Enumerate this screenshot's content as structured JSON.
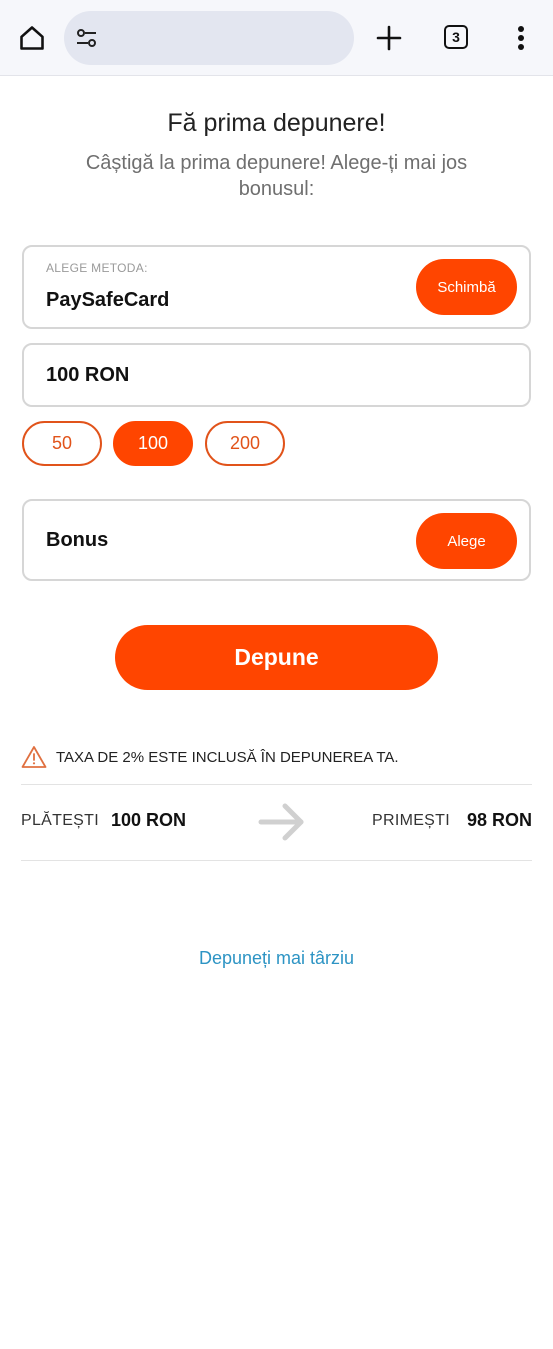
{
  "browser": {
    "tab_count": "3",
    "icons": {
      "home": "home-icon",
      "site_settings": "tune-icon",
      "new_tab": "plus-icon",
      "tabs": "tabs-icon",
      "menu": "more-vert-icon"
    }
  },
  "page": {
    "title": "Fă prima depunere!",
    "subtitle": "Câștigă la prima depunere! Alege-ți mai jos bonusul:"
  },
  "payment_method": {
    "label": "ALEGE METODA:",
    "value": "PaySafeCard",
    "change_label": "Schimbă"
  },
  "amount": {
    "value": "100 RON",
    "presets": [
      {
        "label": "50",
        "selected": false
      },
      {
        "label": "100",
        "selected": true
      },
      {
        "label": "200",
        "selected": false
      }
    ]
  },
  "bonus": {
    "label": "Bonus",
    "choose_label": "Alege"
  },
  "deposit_button_label": "Depune",
  "fee_notice": {
    "icon": "warning-icon",
    "text": "TAXA DE 2% ESTE INCLUSĂ ÎN DEPUNEREA TA."
  },
  "summary": {
    "pay_label": "PLĂTEȘTI",
    "pay_value": "100 RON",
    "arrow_icon": "arrow-right-icon",
    "receive_label": "PRIMEȘTI",
    "receive_value": "98 RON"
  },
  "later_link": "Depuneți mai târziu",
  "colors": {
    "accent": "#ff4500",
    "chip_border": "#e1531a",
    "link": "#2d94c4",
    "warning": "#e07040"
  }
}
